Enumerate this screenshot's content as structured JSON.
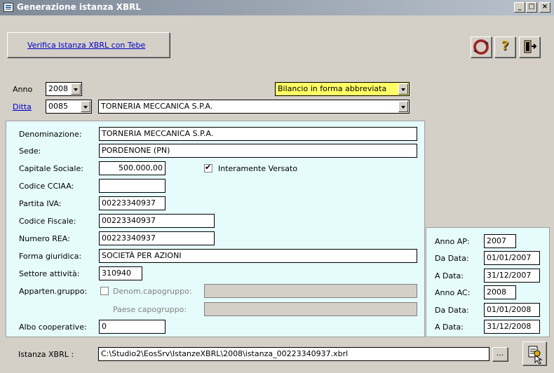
{
  "window": {
    "title": "Generazione istanza XBRL",
    "controls": [
      "_",
      "□",
      "×"
    ]
  },
  "toolbar": {
    "verify_link": "Verifica Istanza XBRL con Tebe",
    "icons": [
      "refresh-icon",
      "help-icon",
      "exit-icon"
    ],
    "help_glyph": "?"
  },
  "header": {
    "anno_label": "Anno",
    "anno_value": "2008",
    "bilancio_value": "Bilancio in forma abbreviata",
    "ditta_label": "Ditta",
    "ditta_code": "0085",
    "ditta_name": "TORNERIA MECCANICA S.P.A."
  },
  "form": {
    "denominazione_label": "Denominazione:",
    "denominazione_value": "TORNERIA MECCANICA S.P.A.",
    "sede_label": "Sede:",
    "sede_value": "PORDENONE (PN)",
    "capitale_label": "Capitale Sociale:",
    "capitale_value": "500.000,00",
    "versato_label": "Interamente Versato",
    "cciaa_label": "Codice CCIAA:",
    "cciaa_value": "",
    "piva_label": "Partita IVA:",
    "piva_value": "00223340937",
    "cf_label": "Codice Fiscale:",
    "cf_value": "00223340937",
    "rea_label": "Numero REA:",
    "rea_value": "00223340937",
    "forma_label": "Forma giuridica:",
    "forma_value": "SOCIETÀ PER AZIONI",
    "settore_label": "Settore attività:",
    "settore_value": "310940",
    "gruppo_label": "Apparten.gruppo:",
    "denom_capo_label": "Denom.capogruppo:",
    "paese_capo_label": "Paese capogruppo:",
    "albo_label": "Albo cooperative:",
    "albo_value": "0"
  },
  "dates": {
    "anno_ap_label": "Anno AP:",
    "anno_ap_value": "2007",
    "da_data_1_label": "Da Data:",
    "da_data_1_value": "01/01/2007",
    "a_data_1_label": "A Data:",
    "a_data_1_value": "31/12/2007",
    "anno_ac_label": "Anno AC:",
    "anno_ac_value": "2008",
    "da_data_2_label": "Da Data:",
    "da_data_2_value": "01/01/2008",
    "a_data_2_label": "A Data:",
    "a_data_2_value": "31/12/2008"
  },
  "footer": {
    "istanza_label": "Istanza XBRL :",
    "istanza_path": "C:\\Studio2\\EosSrv\\IstanzeXBRL\\2008\\istanza_00223340937.xbrl",
    "browse_label": "..."
  }
}
